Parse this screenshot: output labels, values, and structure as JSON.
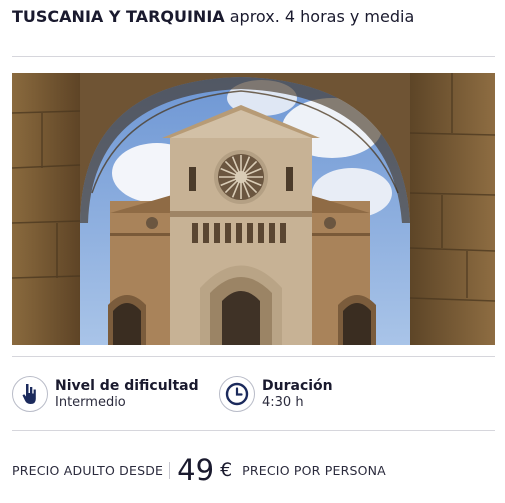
{
  "tour": {
    "title_strong": "TUSCANIA Y TARQUINIA",
    "title_rest": " aprox. 4 horas y media"
  },
  "difficulty": {
    "label": "Nivel de dificultad",
    "value": "Intermedio",
    "icon": "hand-icon"
  },
  "duration": {
    "label": "Duración",
    "value": "4:30 h",
    "icon": "clock-icon"
  },
  "price": {
    "from_label": "PRECIO ADULTO DESDE",
    "amount": "49",
    "currency": "€",
    "per_label": "PRECIO POR PERSONA"
  },
  "colors": {
    "text": "#1a1a2e",
    "icon": "#1b2a5c",
    "divider": "#d6d6dc"
  }
}
